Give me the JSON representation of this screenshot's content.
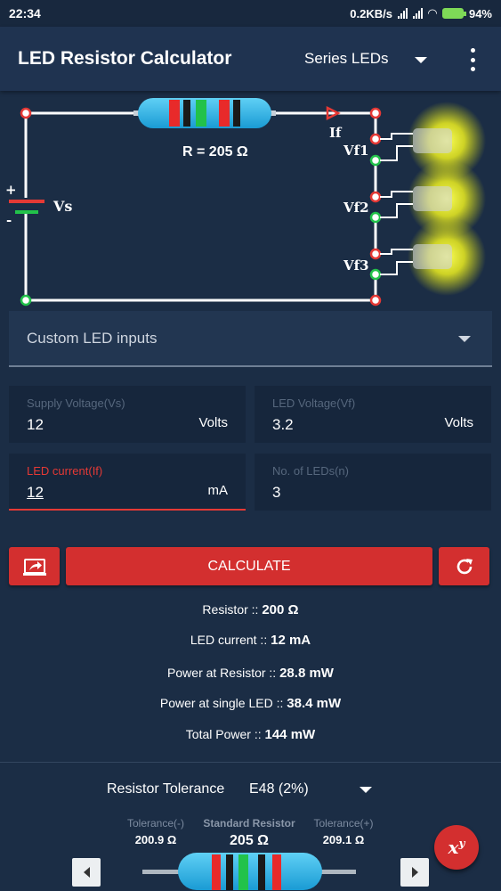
{
  "status_bar": {
    "time": "22:34",
    "speed": "0.2KB/s",
    "battery": "94%"
  },
  "app_bar": {
    "title": "LED Resistor Calculator",
    "mode": "Series LEDs"
  },
  "circuit": {
    "resistor_label": "R = 205 Ω",
    "current_label": "If",
    "supply_label": "Vs",
    "plus": "+",
    "minus": "-",
    "led_labels": [
      "Vf1",
      "Vf2",
      "Vf3"
    ]
  },
  "led_dropdown": {
    "value": "Custom LED inputs"
  },
  "fields": {
    "supply": {
      "label": "Supply Voltage(Vs)",
      "value": "12",
      "unit": "Volts"
    },
    "led_voltage": {
      "label": "LED Voltage(Vf)",
      "value": "3.2",
      "unit": "Volts"
    },
    "led_current": {
      "label": "LED current(If)",
      "value": "12",
      "unit": "mA"
    },
    "led_count": {
      "label": "No. of LEDs(n)",
      "value": "3"
    }
  },
  "buttons": {
    "calculate": "CALCULATE"
  },
  "results": [
    {
      "label": "Resistor :: ",
      "value": "200 Ω"
    },
    {
      "label": "LED current :: ",
      "value": "12 mA"
    },
    {
      "label": "Power at Resistor :: ",
      "value": "28.8 mW"
    },
    {
      "label": "Power at single LED :: ",
      "value": "38.4 mW"
    },
    {
      "label": "Total Power :: ",
      "value": "144 mW"
    }
  ],
  "tolerance": {
    "label": "Resistor Tolerance",
    "value": "E48 (2%)",
    "minus_caption": "Tolerance(-)",
    "minus_value": "200.9 Ω",
    "standard_caption": "Standard Resistor",
    "standard_value": "205 Ω",
    "plus_caption": "Tolerance(+)",
    "plus_value": "209.1 Ω"
  },
  "fab": {
    "base": "x",
    "exp": "y"
  },
  "colors": {
    "accent": "#d32f2f",
    "background": "#1b2d45",
    "led_glow": "#f5f03a",
    "wire": "#ffffff"
  }
}
